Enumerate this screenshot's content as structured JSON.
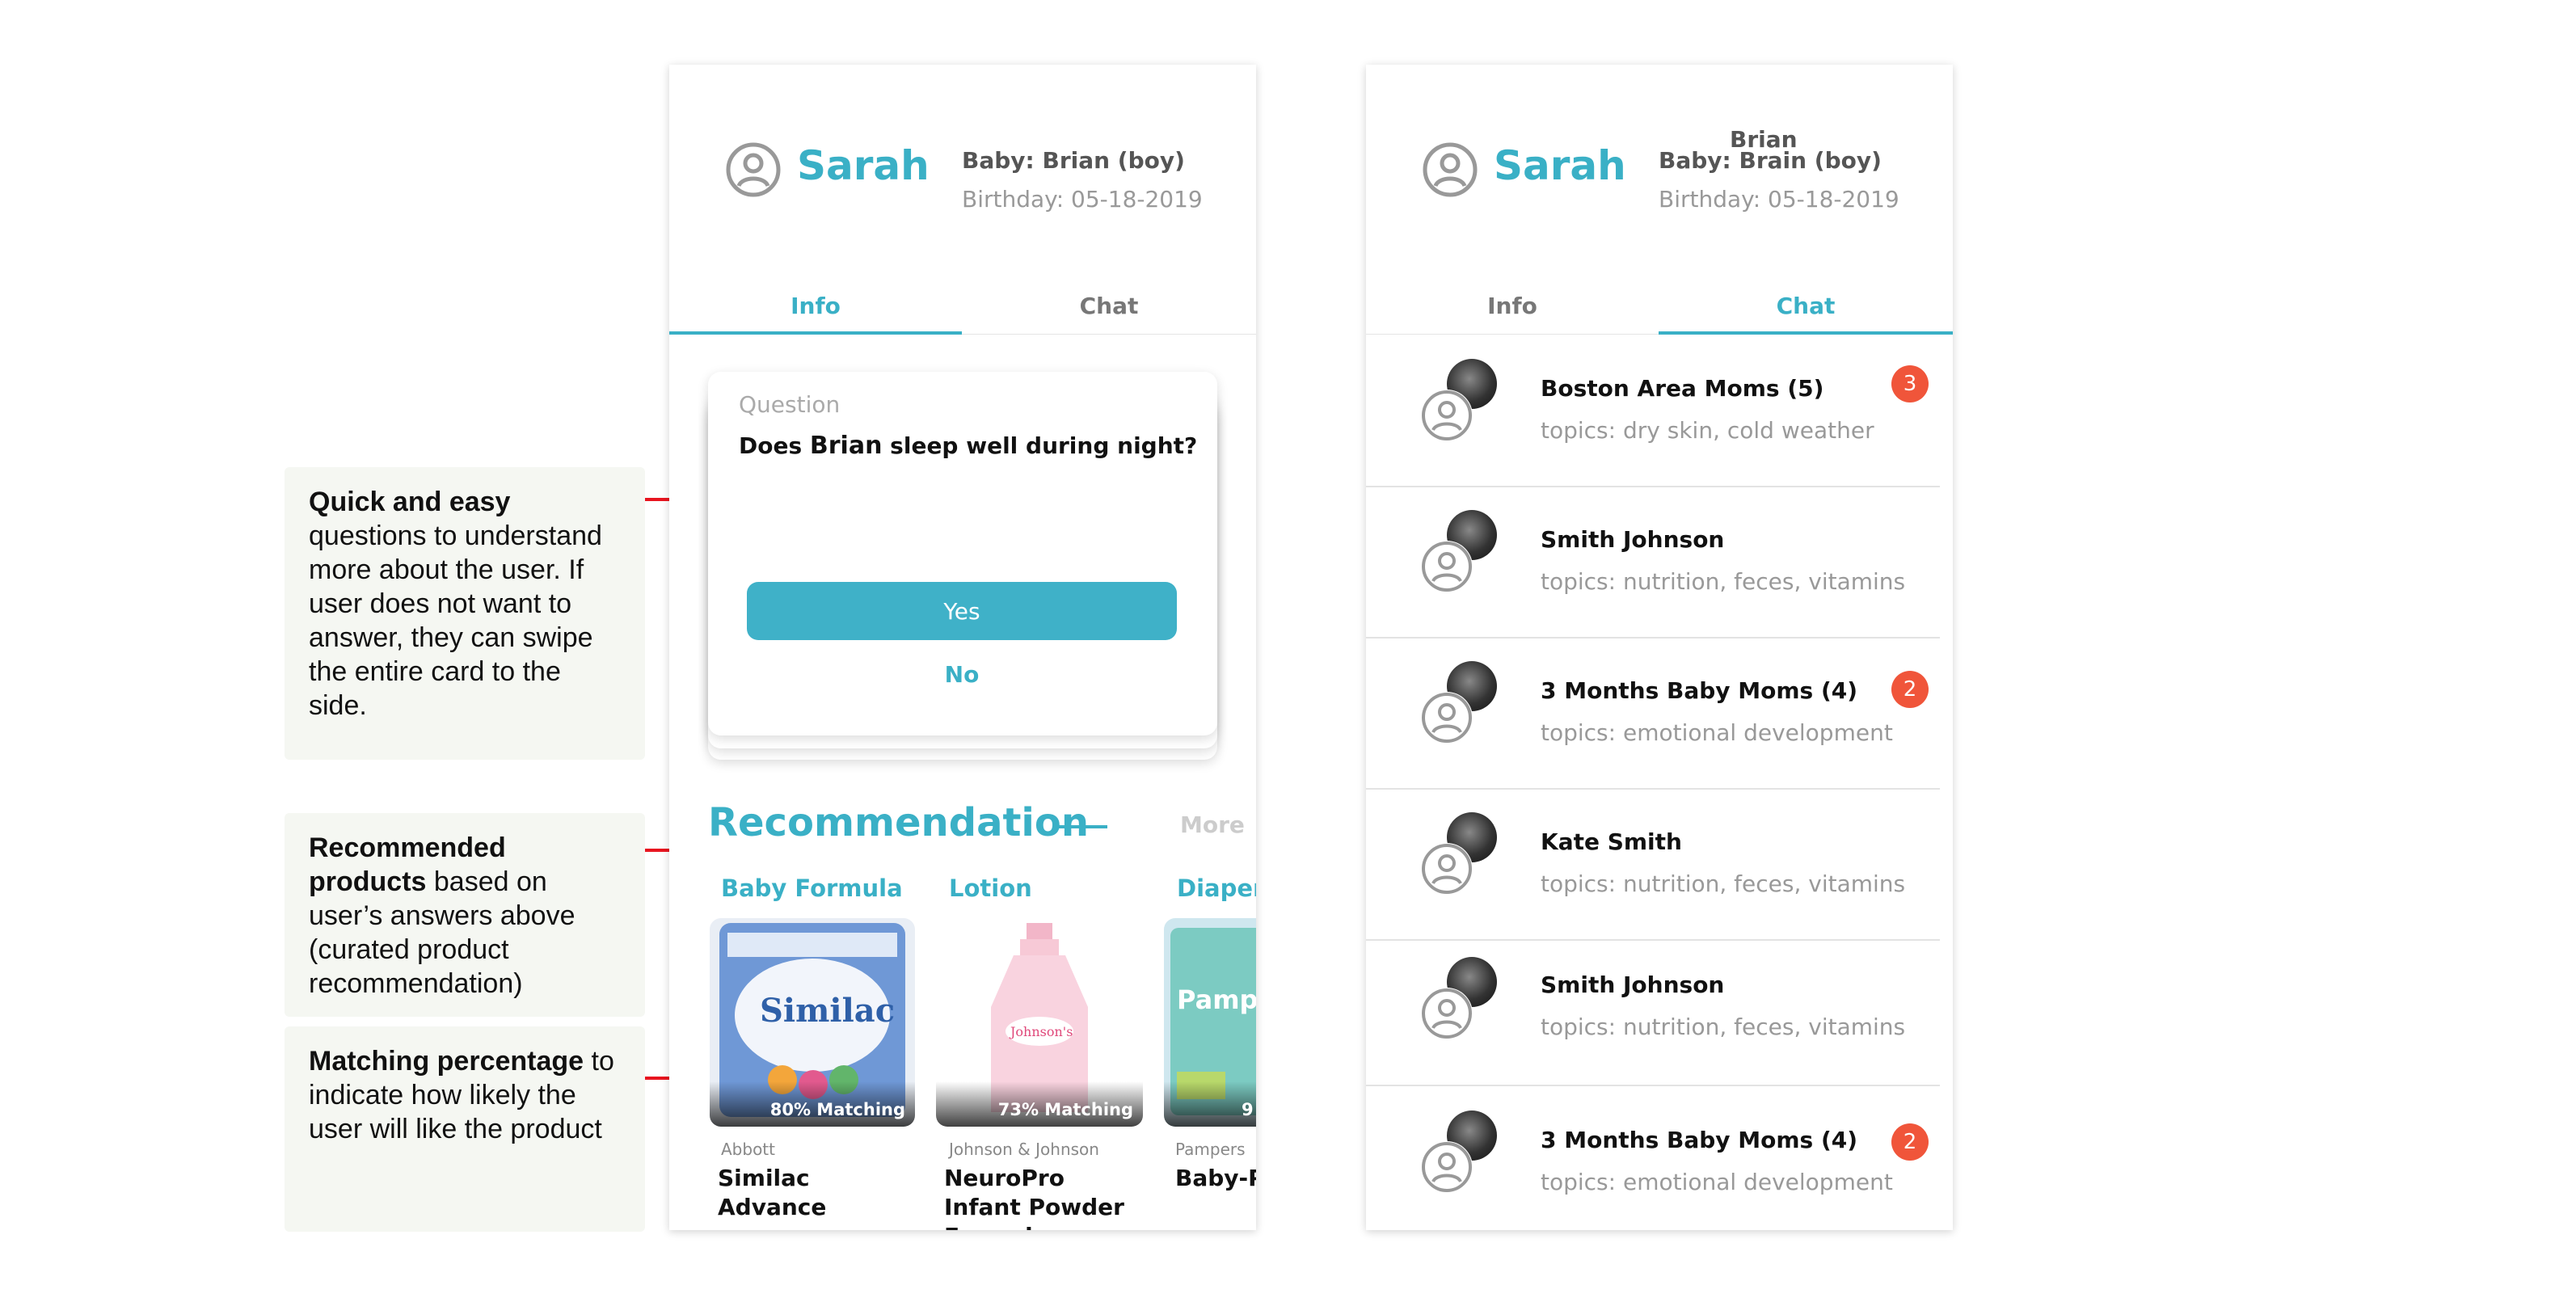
{
  "annotations": [
    {
      "bold": "Quick and easy",
      "text": " questions to understand more about the user. If user does not want to answer, they can swipe the entire card to the side."
    },
    {
      "bold": "Recommended products",
      "text": " based on user’s answers above (curated product recommendation)"
    },
    {
      "bold": "Matching percentage",
      "text": " to indicate how likely the user will like the product"
    }
  ],
  "colors": {
    "accent": "#3ab0c6",
    "badge": "#f0553a",
    "annotation_line": "#e8141f"
  },
  "left_phone": {
    "user_name": "Sarah",
    "baby": "Baby: Brian (boy)",
    "birthday": "Birthday: 05-18-2019",
    "tabs": [
      "Info",
      "Chat"
    ],
    "active_tab": "Info",
    "question_card": {
      "label": "Question",
      "question_prefix": "Does ",
      "question_name": "Brian",
      "question_suffix": " sleep well during night?",
      "yes": "Yes",
      "no": "No"
    },
    "recommendation": {
      "title": "Recommendation",
      "more": "More",
      "products": [
        {
          "category": "Baby Formula",
          "match": "80% Matching",
          "brand": "Abbott",
          "name_lines": [
            "Similac",
            "Advance"
          ]
        },
        {
          "category": "Lotion",
          "match": "73% Matching",
          "brand": "Johnson & Johnson",
          "name_lines": [
            "NeuroPro",
            "Infant Powder",
            "Formula"
          ]
        },
        {
          "category": "Diapers",
          "match": "9",
          "brand": "Pampers",
          "name_lines": [
            "Baby-Pa"
          ]
        }
      ]
    }
  },
  "right_phone": {
    "user_name": "Sarah",
    "baby_overlay": "Brian",
    "baby": "Baby: Brain (boy)",
    "birthday": "Birthday: 05-18-2019",
    "tabs": [
      "Info",
      "Chat"
    ],
    "active_tab": "Chat",
    "chats": [
      {
        "title": "Boston Area Moms (5)",
        "topics": "topics: dry skin, cold weather",
        "badge": "3"
      },
      {
        "title": "Smith Johnson",
        "topics": "topics: nutrition, feces, vitamins",
        "badge": ""
      },
      {
        "title": "3 Months Baby Moms (4)",
        "topics": "topics: emotional development",
        "badge": "2"
      },
      {
        "title": "Kate Smith",
        "topics": "topics: nutrition, feces, vitamins",
        "badge": ""
      },
      {
        "title": "Smith Johnson",
        "topics": "topics: nutrition, feces, vitamins",
        "badge": ""
      },
      {
        "title": "3 Months Baby Moms (4)",
        "topics": "topics: emotional development",
        "badge": "2"
      }
    ]
  }
}
